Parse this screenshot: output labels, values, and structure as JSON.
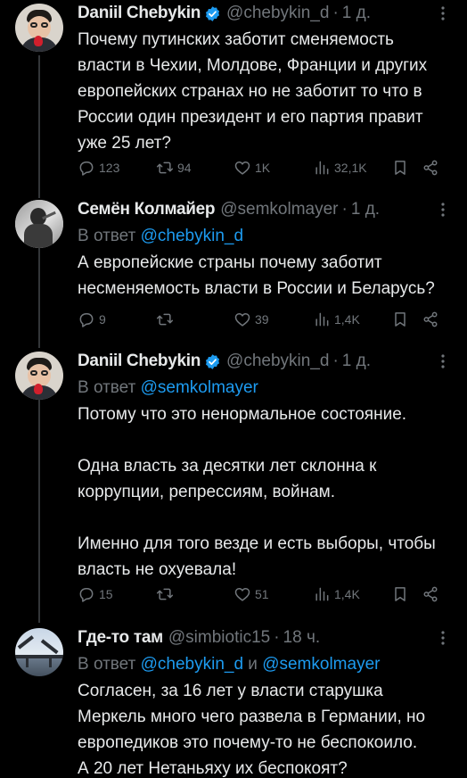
{
  "tweets": [
    {
      "name": "Daniil Chebykin",
      "verified": true,
      "handle": "@chebykin_d",
      "dot": "·",
      "time": "1 д.",
      "reply_prefix": "",
      "reply_mention_1": "",
      "reply_and": "",
      "reply_mention_2": "",
      "text": "Почему путинских заботит сменяемость\nвласти в Чехии, Молдове, Франции и других\nевропейских странах но не заботит то что в\nРоссии один президент и его партия правит\nуже 25 лет?",
      "replies": "123",
      "retweets": "94",
      "likes": "1K",
      "views": "32,1K"
    },
    {
      "name": "Семён Колмайер",
      "verified": false,
      "handle": "@semkolmayer",
      "dot": "·",
      "time": "1 д.",
      "reply_prefix": "В ответ ",
      "reply_mention_1": "@chebykin_d",
      "reply_and": "",
      "reply_mention_2": "",
      "text": "А европейские страны почему заботит\nнесменяемость власти в России и Беларусь?",
      "replies": "9",
      "retweets": "",
      "likes": "39",
      "views": "1,4K"
    },
    {
      "name": "Daniil Chebykin",
      "verified": true,
      "handle": "@chebykin_d",
      "dot": "·",
      "time": "1 д.",
      "reply_prefix": "В ответ ",
      "reply_mention_1": "@semkolmayer",
      "reply_and": "",
      "reply_mention_2": "",
      "text": "Потому что это ненормальное состояние.\n\nОдна власть за десятки лет склонна к\nкоррупции, репрессиям, войнам.\n\nИменно для того везде и есть выборы, чтобы\nвласть не охуевала!",
      "replies": "15",
      "retweets": "",
      "likes": "51",
      "views": "1,4K"
    },
    {
      "name": "Где-то там",
      "verified": false,
      "handle": "@simbiotic15",
      "dot": "·",
      "time": "18 ч.",
      "reply_prefix": "В ответ ",
      "reply_mention_1": "@chebykin_d",
      "reply_and": " и ",
      "reply_mention_2": "@semkolmayer",
      "text": "Согласен, за 16 лет у власти старушка\nМеркель много чего развела в Германии, но\nевропедиков это почему-то не беспокоило.\nА 20 лет Нетаньяху их беспокоят?",
      "replies": "",
      "retweets": "",
      "likes": "",
      "views": ""
    }
  ],
  "colors": {
    "background": "#000000",
    "text": "#e7e9ea",
    "secondary": "#71767b",
    "link": "#1d9bf0",
    "verified": "#1d9bf0",
    "thread_line": "#333639"
  },
  "icons": [
    "verified-badge-icon",
    "more-icon",
    "reply-icon",
    "retweet-icon",
    "like-icon",
    "views-icon",
    "bookmark-icon",
    "share-icon"
  ]
}
